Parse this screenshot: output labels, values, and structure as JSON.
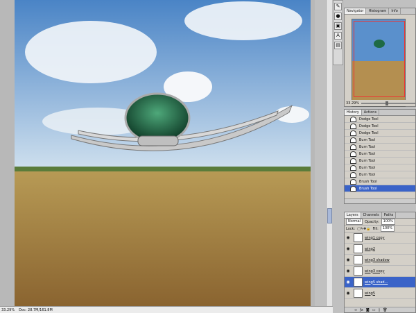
{
  "status": {
    "zoom": "33.29%",
    "doc_info": "Doc: 28.7M/161.8M"
  },
  "navigator": {
    "tabs": [
      "Navigator",
      "Histogram",
      "Info"
    ],
    "zoom": "33.29%"
  },
  "history": {
    "tabs": [
      "History",
      "Actions"
    ],
    "items": [
      "Dodge Tool",
      "Dodge Tool",
      "Dodge Tool",
      "Burn Tool",
      "Burn Tool",
      "Burn Tool",
      "Burn Tool",
      "Burn Tool",
      "Burn Tool",
      "Brush Tool",
      "Brush Tool"
    ],
    "selected": 10
  },
  "layers": {
    "tabs": [
      "Layers",
      "Channels",
      "Paths"
    ],
    "blend_mode": "Normal",
    "opacity_label": "Opacity:",
    "opacity": "100%",
    "lock_label": "Lock:",
    "fill_label": "Fill:",
    "fill": "100%",
    "rows": [
      "wing1 copy",
      "wing2",
      "wing3 shadow",
      "wing3 copy",
      "wing5 shad...",
      "wing5"
    ],
    "selected": 4
  },
  "colors": {
    "selection": "#3a63c8",
    "sky_top": "#4f88c8",
    "field": "#c8a050"
  },
  "icons": [
    "eye-icon",
    "folder-icon",
    "brush-icon",
    "dodge-icon",
    "burn-icon",
    "lock-icon",
    "link-icon",
    "trash-icon",
    "new-layer-icon"
  ]
}
